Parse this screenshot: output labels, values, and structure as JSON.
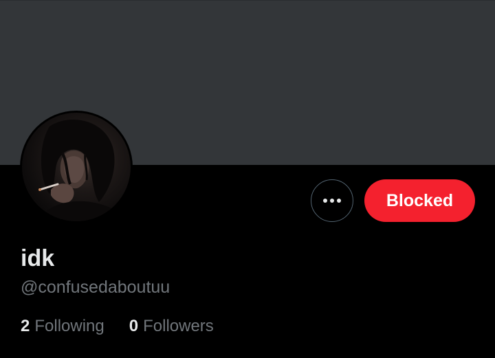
{
  "profile": {
    "display_name": "idk",
    "handle": "@confusedaboutuu"
  },
  "actions": {
    "more_icon": "more-horizontal-icon",
    "blocked_label": "Blocked"
  },
  "stats": {
    "following_count": "2",
    "following_label": "Following",
    "followers_count": "0",
    "followers_label": "Followers"
  },
  "colors": {
    "banner": "#333639",
    "background": "#000000",
    "blocked_button": "#f4212e",
    "primary_text": "#e7e9ea",
    "secondary_text": "#71767b",
    "outline_button_border": "#536471"
  }
}
